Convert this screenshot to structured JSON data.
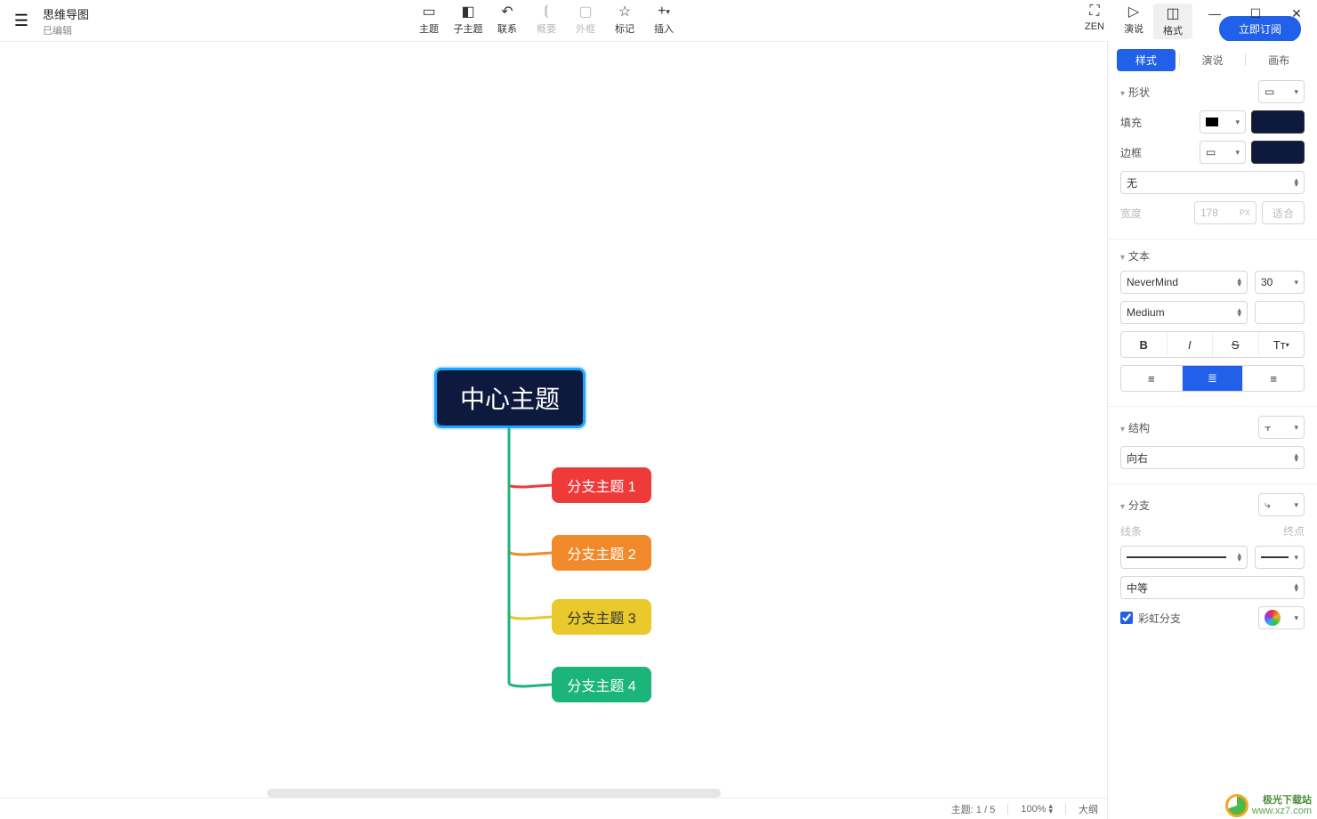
{
  "doc": {
    "title": "思维导图",
    "status": "已编辑"
  },
  "toolbar": {
    "topic": "主题",
    "subtopic": "子主题",
    "relation": "联系",
    "summary": "概要",
    "boundary": "外框",
    "marker": "标记",
    "insert": "插入",
    "zen": "ZEN",
    "present": "演说",
    "format": "格式"
  },
  "subscribe": "立即订阅",
  "inspector": {
    "tabs": {
      "style": "样式",
      "present": "演说",
      "canvas": "画布"
    },
    "shape": {
      "label": "形状"
    },
    "fill": {
      "label": "填充",
      "color": "#0d1a3d"
    },
    "border": {
      "label": "边框",
      "style_none": "无",
      "color": "#0d1a3d"
    },
    "width": {
      "label": "宽度",
      "value": "178",
      "unit": "PX",
      "fit": "适合"
    },
    "text": {
      "label": "文本",
      "font": "NeverMind",
      "size": "30",
      "weight": "Medium"
    },
    "structure": {
      "label": "结构",
      "direction": "向右"
    },
    "branch": {
      "label": "分支",
      "line_label": "线条",
      "end_label": "终点",
      "width_label": "中等",
      "rainbow": "彩虹分支"
    }
  },
  "mindmap": {
    "center": "中心主题",
    "branches": [
      "分支主题 1",
      "分支主题 2",
      "分支主题 3",
      "分支主题 4"
    ]
  },
  "status": {
    "topic_count": "主题: 1 / 5",
    "zoom": "100%",
    "outline": "大纲"
  },
  "watermark": {
    "name": "极光下载站",
    "url": "www.xz7.com"
  }
}
